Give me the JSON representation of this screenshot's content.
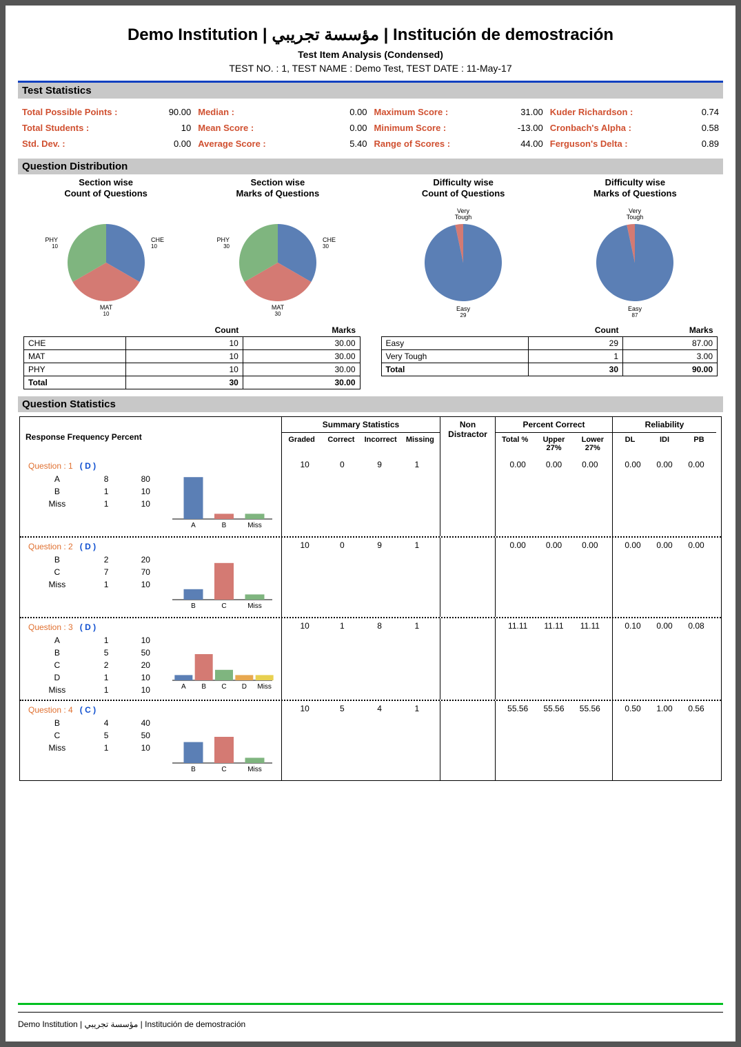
{
  "header": {
    "title": "Demo Institution | مؤسسة تجريبي | Institución de demostración",
    "subtitle": "Test Item Analysis (Condensed)",
    "meta": "TEST NO. : 1, TEST NAME : Demo Test, TEST DATE : 11-May-17"
  },
  "sections": {
    "test_stats": "Test Statistics",
    "q_dist": "Question Distribution",
    "q_stats": "Question Statistics"
  },
  "stats": [
    [
      {
        "label": "Total Possible Points :",
        "value": "90.00"
      },
      {
        "label": "Total Students :",
        "value": "10"
      },
      {
        "label": "Std. Dev. :",
        "value": "0.00"
      }
    ],
    [
      {
        "label": "Median :",
        "value": "0.00"
      },
      {
        "label": "Mean Score :",
        "value": "0.00"
      },
      {
        "label": "Average Score :",
        "value": "5.40"
      }
    ],
    [
      {
        "label": "Maximum Score :",
        "value": "31.00"
      },
      {
        "label": "Minimum Score :",
        "value": "-13.00"
      },
      {
        "label": "Range of Scores :",
        "value": "44.00"
      }
    ],
    [
      {
        "label": "Kuder Richardson :",
        "value": "0.74"
      },
      {
        "label": "Cronbach's Alpha :",
        "value": "0.58"
      },
      {
        "label": "Ferguson's Delta :",
        "value": "0.89"
      }
    ]
  ],
  "pies": {
    "sec_count": {
      "title1": "Section wise",
      "title2": "Count of Questions"
    },
    "sec_marks": {
      "title1": "Section wise",
      "title2": "Marks of Questions"
    },
    "dif_count": {
      "title1": "Difficulty wise",
      "title2": "Count of Questions"
    },
    "dif_marks": {
      "title1": "Difficulty wise",
      "title2": "Marks of Questions"
    }
  },
  "sec_table": {
    "hdr_count": "Count",
    "hdr_marks": "Marks",
    "rows": [
      {
        "name": "CHE",
        "count": "10",
        "marks": "30.00"
      },
      {
        "name": "MAT",
        "count": "10",
        "marks": "30.00"
      },
      {
        "name": "PHY",
        "count": "10",
        "marks": "30.00"
      },
      {
        "name": "Total",
        "count": "30",
        "marks": "30.00"
      }
    ]
  },
  "dif_table": {
    "hdr_count": "Count",
    "hdr_marks": "Marks",
    "rows": [
      {
        "name": "Easy",
        "count": "29",
        "marks": "87.00"
      },
      {
        "name": "Very Tough",
        "count": "1",
        "marks": "3.00"
      },
      {
        "name": "Total",
        "count": "30",
        "marks": "90.00"
      }
    ]
  },
  "qhdr": {
    "rfp": "Response  Frequency  Percent",
    "summary": "Summary Statistics",
    "graded": "Graded",
    "correct": "Correct",
    "incorrect": "Incorrect",
    "missing": "Missing",
    "nondist1": "Non",
    "nondist2": "Distractor",
    "pct": "Percent Correct",
    "total": "Total %",
    "upper": "Upper 27%",
    "lower": "Lower 27%",
    "rel": "Reliability",
    "dl": "DL",
    "idi": "IDI",
    "pb": "PB"
  },
  "questions": [
    {
      "num": "1",
      "key": "D",
      "resp": [
        {
          "r": "A",
          "f": "8",
          "p": "80"
        },
        {
          "r": "B",
          "f": "1",
          "p": "10"
        },
        {
          "r": "Miss",
          "f": "1",
          "p": "10"
        }
      ],
      "sum": {
        "graded": "10",
        "correct": "0",
        "incorrect": "9",
        "missing": "1"
      },
      "pct": {
        "total": "0.00",
        "upper": "0.00",
        "lower": "0.00"
      },
      "rel": {
        "dl": "0.00",
        "idi": "0.00",
        "pb": "0.00"
      }
    },
    {
      "num": "2",
      "key": "D",
      "resp": [
        {
          "r": "B",
          "f": "2",
          "p": "20"
        },
        {
          "r": "C",
          "f": "7",
          "p": "70"
        },
        {
          "r": "Miss",
          "f": "1",
          "p": "10"
        }
      ],
      "sum": {
        "graded": "10",
        "correct": "0",
        "incorrect": "9",
        "missing": "1"
      },
      "pct": {
        "total": "0.00",
        "upper": "0.00",
        "lower": "0.00"
      },
      "rel": {
        "dl": "0.00",
        "idi": "0.00",
        "pb": "0.00"
      }
    },
    {
      "num": "3",
      "key": "D",
      "resp": [
        {
          "r": "A",
          "f": "1",
          "p": "10"
        },
        {
          "r": "B",
          "f": "5",
          "p": "50"
        },
        {
          "r": "C",
          "f": "2",
          "p": "20"
        },
        {
          "r": "D",
          "f": "1",
          "p": "10"
        },
        {
          "r": "Miss",
          "f": "1",
          "p": "10"
        }
      ],
      "sum": {
        "graded": "10",
        "correct": "1",
        "incorrect": "8",
        "missing": "1"
      },
      "pct": {
        "total": "11.11",
        "upper": "11.11",
        "lower": "11.11"
      },
      "rel": {
        "dl": "0.10",
        "idi": "0.00",
        "pb": "0.08"
      }
    },
    {
      "num": "4",
      "key": "C",
      "resp": [
        {
          "r": "B",
          "f": "4",
          "p": "40"
        },
        {
          "r": "C",
          "f": "5",
          "p": "50"
        },
        {
          "r": "Miss",
          "f": "1",
          "p": "10"
        }
      ],
      "sum": {
        "graded": "10",
        "correct": "5",
        "incorrect": "4",
        "missing": "1"
      },
      "pct": {
        "total": "55.56",
        "upper": "55.56",
        "lower": "55.56"
      },
      "rel": {
        "dl": "0.50",
        "idi": "1.00",
        "pb": "0.56"
      }
    }
  ],
  "footer": "Demo Institution | مؤسسة تجريبي | Institución de demostración",
  "chart_data": [
    {
      "type": "pie",
      "id": "section-count",
      "title": "Section wise Count of Questions",
      "series": [
        {
          "name": "CHE",
          "value": 10
        },
        {
          "name": "MAT",
          "value": 10
        },
        {
          "name": "PHY",
          "value": 10
        }
      ]
    },
    {
      "type": "pie",
      "id": "section-marks",
      "title": "Section wise Marks of Questions",
      "series": [
        {
          "name": "CHE",
          "value": 30
        },
        {
          "name": "MAT",
          "value": 30
        },
        {
          "name": "PHY",
          "value": 30
        }
      ]
    },
    {
      "type": "pie",
      "id": "difficulty-count",
      "title": "Difficulty wise Count of Questions",
      "series": [
        {
          "name": "Easy",
          "value": 29
        },
        {
          "name": "Very Tough",
          "value": 1
        }
      ]
    },
    {
      "type": "pie",
      "id": "difficulty-marks",
      "title": "Difficulty wise Marks of Questions",
      "series": [
        {
          "name": "Easy",
          "value": 87
        },
        {
          "name": "Very Tough",
          "value": 3
        }
      ]
    },
    {
      "type": "bar",
      "id": "q1-bar",
      "categories": [
        "A",
        "B",
        "Miss"
      ],
      "values": [
        80,
        10,
        10
      ],
      "ylim": [
        0,
        100
      ]
    },
    {
      "type": "bar",
      "id": "q2-bar",
      "categories": [
        "B",
        "C",
        "Miss"
      ],
      "values": [
        20,
        70,
        10
      ],
      "ylim": [
        0,
        100
      ]
    },
    {
      "type": "bar",
      "id": "q3-bar",
      "categories": [
        "A",
        "B",
        "C",
        "D",
        "Miss"
      ],
      "values": [
        10,
        50,
        20,
        10,
        10
      ],
      "ylim": [
        0,
        100
      ]
    },
    {
      "type": "bar",
      "id": "q4-bar",
      "categories": [
        "B",
        "C",
        "Miss"
      ],
      "values": [
        40,
        50,
        10
      ],
      "ylim": [
        0,
        100
      ]
    }
  ]
}
